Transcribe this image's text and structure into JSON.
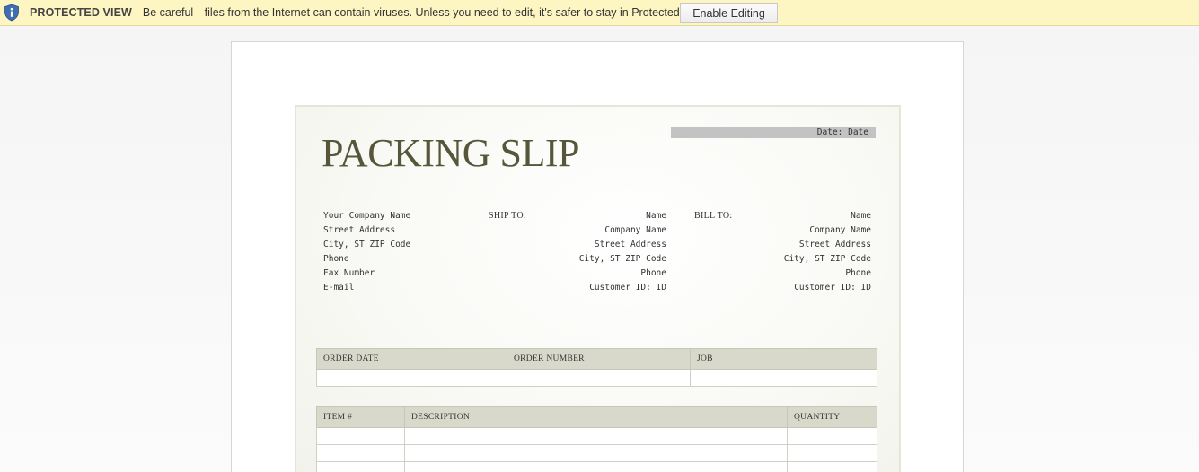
{
  "protected_view": {
    "label": "PROTECTED VIEW",
    "message": "Be careful—files from the Internet can contain viruses. Unless you need to edit, it's safer to stay in Protected View.",
    "button": "Enable Editing",
    "icon": "info-shield-icon",
    "accent": "#fdf6c3"
  },
  "slip": {
    "title": "PACKING SLIP",
    "date": "Date: Date",
    "company_lines": [
      "Your Company Name",
      "Street Address",
      "City, ST ZIP Code",
      "Phone",
      "Fax Number",
      "E-mail"
    ],
    "ship_to_label": "SHIP TO:",
    "ship_to_lines": [
      "Name",
      "Company Name",
      "Street Address",
      "City, ST ZIP Code",
      "Phone",
      "Customer ID: ID"
    ],
    "bill_to_label": "BILL TO:",
    "bill_to_lines": [
      "Name",
      "Company Name",
      "Street Address",
      "City, ST ZIP Code",
      "Phone",
      "Customer ID: ID"
    ],
    "order_headers": [
      "ORDER DATE",
      "ORDER NUMBER",
      "JOB"
    ],
    "item_headers": [
      "ITEM #",
      "DESCRIPTION",
      "QUANTITY"
    ],
    "title_color": "#56573a",
    "header_fill": "#d9d9cb"
  }
}
